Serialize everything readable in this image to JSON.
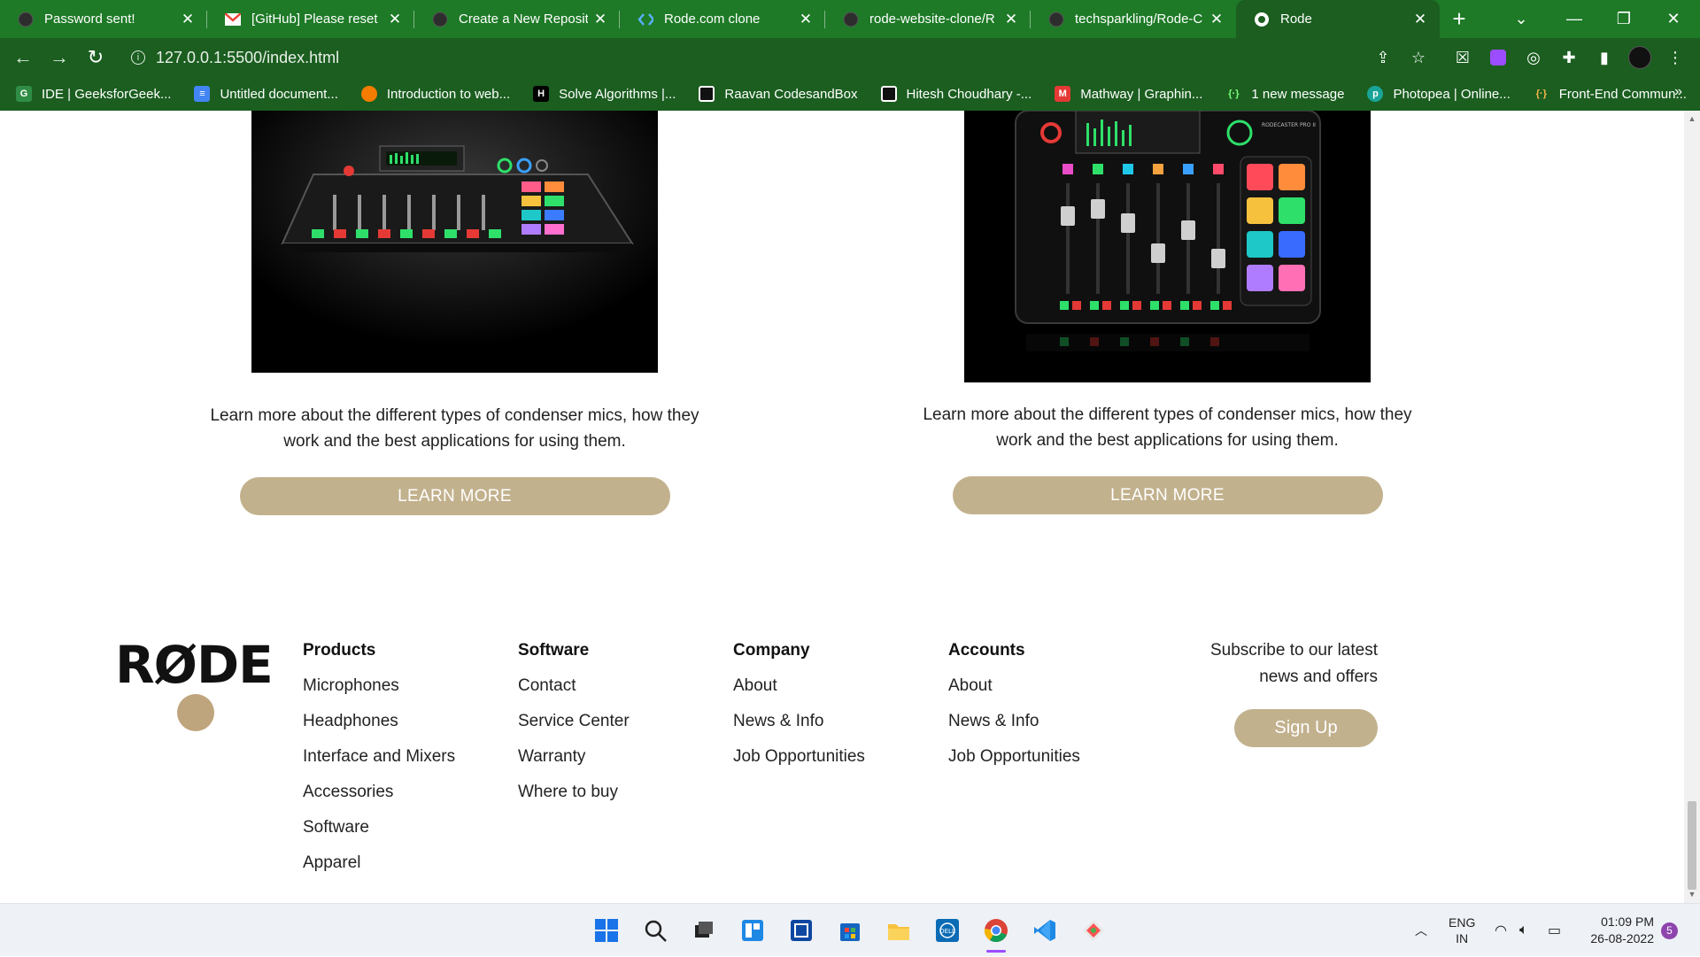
{
  "browser": {
    "tabs": [
      {
        "title": "Password sent!",
        "icon": "github-icon"
      },
      {
        "title": "[GitHub] Please reset",
        "icon": "gmail-icon"
      },
      {
        "title": "Create a New Reposit",
        "icon": "github-icon"
      },
      {
        "title": "Rode.com clone",
        "icon": "code-icon"
      },
      {
        "title": "rode-website-clone/R",
        "icon": "github-icon"
      },
      {
        "title": "techsparkling/Rode-C",
        "icon": "github-icon"
      },
      {
        "title": "Rode",
        "icon": "globe-icon"
      }
    ],
    "active_tab_index": 6,
    "url": "127.0.0.1:5500/index.html",
    "bookmarks": [
      {
        "label": "IDE | GeeksforGeek...",
        "icon": "gfg-icon"
      },
      {
        "label": "Untitled document...",
        "icon": "docs-icon"
      },
      {
        "label": "Introduction to web...",
        "icon": "orange-circle-icon"
      },
      {
        "label": "Solve Algorithms |...",
        "icon": "hackerrank-icon"
      },
      {
        "label": "Raavan CodesandBox",
        "icon": "codesandbox-icon"
      },
      {
        "label": "Hitesh Choudhary -...",
        "icon": "codesandbox-icon"
      },
      {
        "label": "Mathway | Graphin...",
        "icon": "mathway-icon"
      },
      {
        "label": "1 new message",
        "icon": "braces-icon"
      },
      {
        "label": "Photopea | Online...",
        "icon": "photopea-icon"
      },
      {
        "label": "Front-End Commun...",
        "icon": "frontend-icon"
      }
    ]
  },
  "page": {
    "cards": [
      {
        "description": "Learn more about the different types of condenser mics, how they work and the best applications for using them.",
        "button": "LEARN MORE"
      },
      {
        "description": "Learn more about the different types of condenser mics, how they work and the best applications for using them.",
        "button": "LEARN MORE"
      }
    ],
    "footer": {
      "logo": "RØDE",
      "columns": [
        {
          "heading": "Products",
          "links": [
            "Microphones",
            "Headphones",
            "Interface and Mixers",
            "Accessories",
            "Software",
            "Apparel"
          ]
        },
        {
          "heading": "Software",
          "links": [
            "Contact",
            "Service Center",
            "Warranty",
            "Where to buy"
          ]
        },
        {
          "heading": "Company",
          "links": [
            "About",
            "News & Info",
            "Job Opportunities"
          ]
        },
        {
          "heading": "Accounts",
          "links": [
            "About",
            "News & Info",
            "Job Opportunities"
          ]
        }
      ],
      "subscribe_line1": "Subscribe to our latest",
      "subscribe_line2": "news and offers",
      "signup_button": "Sign Up"
    }
  },
  "taskbar": {
    "lang_line1": "ENG",
    "lang_line2": "IN",
    "time": "01:09 PM",
    "date": "26-08-2022",
    "notification_count": "5"
  },
  "colors": {
    "chrome_green": "#1b5e20",
    "accent_tan": "#c2b18d"
  }
}
